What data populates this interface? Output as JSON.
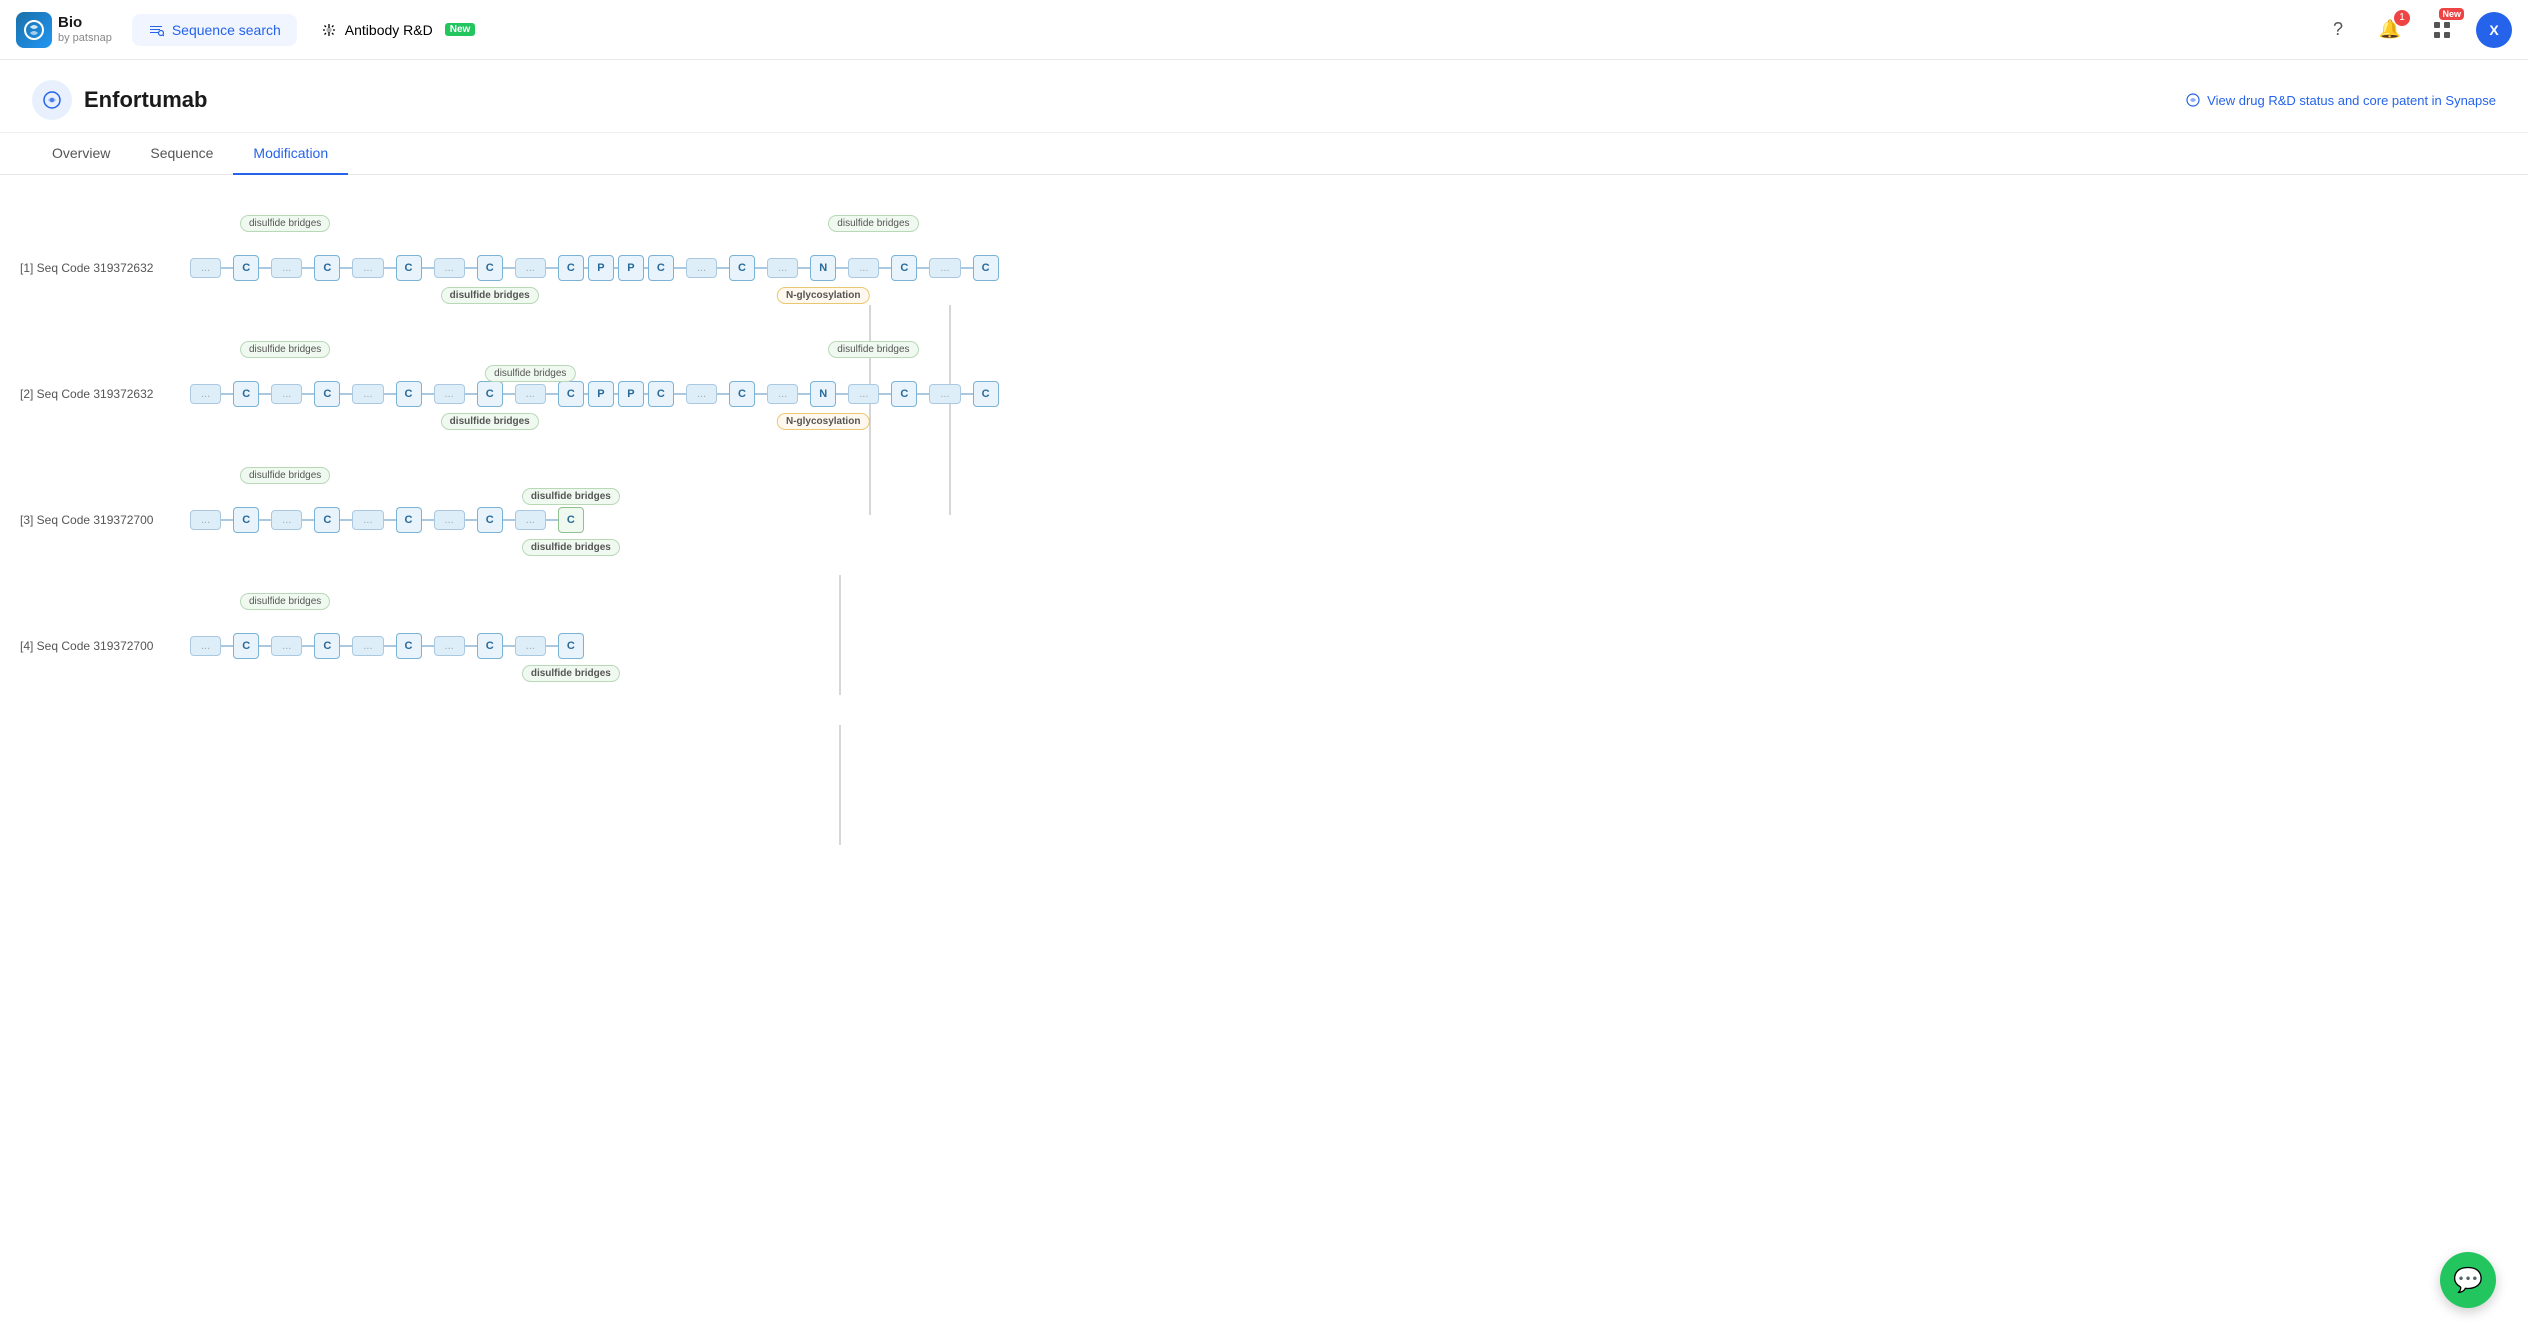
{
  "header": {
    "logo_bio": "Bio",
    "logo_by": "by patsnap",
    "nav_sequence": "Sequence search",
    "nav_antibody": "Antibody R&D",
    "antibody_badge": "New",
    "help_icon": "?",
    "notification_count": "1",
    "new_badge": "New",
    "avatar_letter": "X"
  },
  "page": {
    "drug_name": "Enfortumab",
    "synapse_link": "View drug R&D status and core patent in Synapse"
  },
  "tabs": [
    {
      "id": "overview",
      "label": "Overview"
    },
    {
      "id": "sequence",
      "label": "Sequence"
    },
    {
      "id": "modification",
      "label": "Modification",
      "active": true
    }
  ],
  "sequences": [
    {
      "id": "seq1",
      "label": "[1] Seq Code 319372632",
      "nodes": [
        "C",
        "C",
        "C",
        "C",
        "C",
        "P",
        "P",
        "C",
        "C",
        "N",
        "C",
        "C"
      ],
      "labels_above": [
        "disulfide bridges",
        "disulfide bridges"
      ],
      "labels_below": [
        "disulfide bridges"
      ],
      "nglyc": "N-glycosylation"
    },
    {
      "id": "seq2",
      "label": "[2] Seq Code 319372632",
      "nodes": [
        "C",
        "C",
        "C",
        "C",
        "C",
        "P",
        "P",
        "C",
        "C",
        "N",
        "C",
        "C"
      ],
      "labels_above": [
        "disulfide bridges",
        "disulfide bridges",
        "disulfide bridges"
      ],
      "labels_below": [
        "disulfide bridges"
      ],
      "nglyc": "N-glycosylation"
    },
    {
      "id": "seq3",
      "label": "[3] Seq Code 319372700",
      "nodes": [
        "C",
        "C",
        "C",
        "C",
        "C"
      ],
      "labels_above": [
        "disulfide bridges"
      ],
      "labels_below": [
        "disulfide bridges",
        "disulfide bridges"
      ]
    },
    {
      "id": "seq4",
      "label": "[4] Seq Code 319372700",
      "nodes": [
        "C",
        "C",
        "C",
        "C",
        "C"
      ],
      "labels_above": [
        "disulfide bridges"
      ],
      "labels_below": [
        "disulfide bridges"
      ]
    }
  ]
}
